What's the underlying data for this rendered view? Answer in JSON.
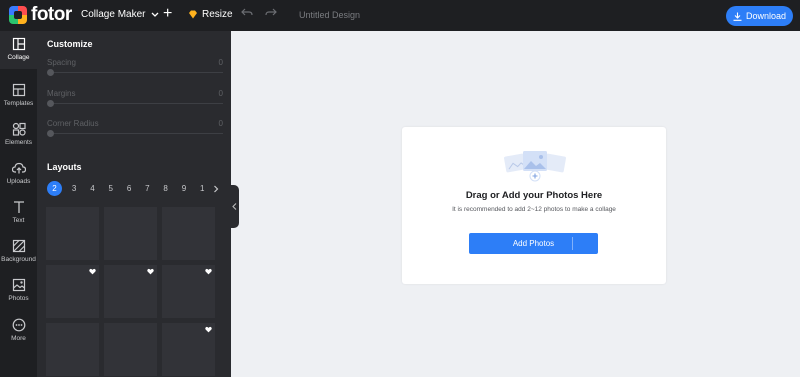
{
  "app": {
    "logo_text": "fotor"
  },
  "topbar": {
    "menu_label": "Collage Maker",
    "resize_label": "Resize",
    "design_title": "Untitled Design",
    "download_label": "Download"
  },
  "rail": {
    "items": [
      {
        "label": "Collage",
        "icon": "collage-icon"
      },
      {
        "label": "Templates",
        "icon": "templates-icon"
      },
      {
        "label": "Elements",
        "icon": "elements-icon"
      },
      {
        "label": "Uploads",
        "icon": "uploads-icon"
      },
      {
        "label": "Text",
        "icon": "text-icon"
      },
      {
        "label": "Background",
        "icon": "background-icon"
      },
      {
        "label": "Photos",
        "icon": "photos-icon"
      },
      {
        "label": "More",
        "icon": "more-icon"
      }
    ]
  },
  "panel": {
    "customize_title": "Customize",
    "sliders": [
      {
        "label": "Spacing",
        "value": "0"
      },
      {
        "label": "Margins",
        "value": "0"
      },
      {
        "label": "Corner Radius",
        "value": "0"
      }
    ],
    "layouts_title": "Layouts",
    "pages": [
      "2",
      "3",
      "4",
      "5",
      "6",
      "7",
      "8",
      "9",
      "1"
    ],
    "active_page": "2"
  },
  "card": {
    "title": "Drag or Add your Photos Here",
    "description": "It is recommended to add 2~12 photos to make a collage",
    "button_label": "Add Photos"
  },
  "colors": {
    "accent": "#2d7ef7",
    "topbar_bg": "#1e1f22",
    "panel_bg": "#2a2b2f",
    "canvas_bg": "#eef0f3"
  }
}
